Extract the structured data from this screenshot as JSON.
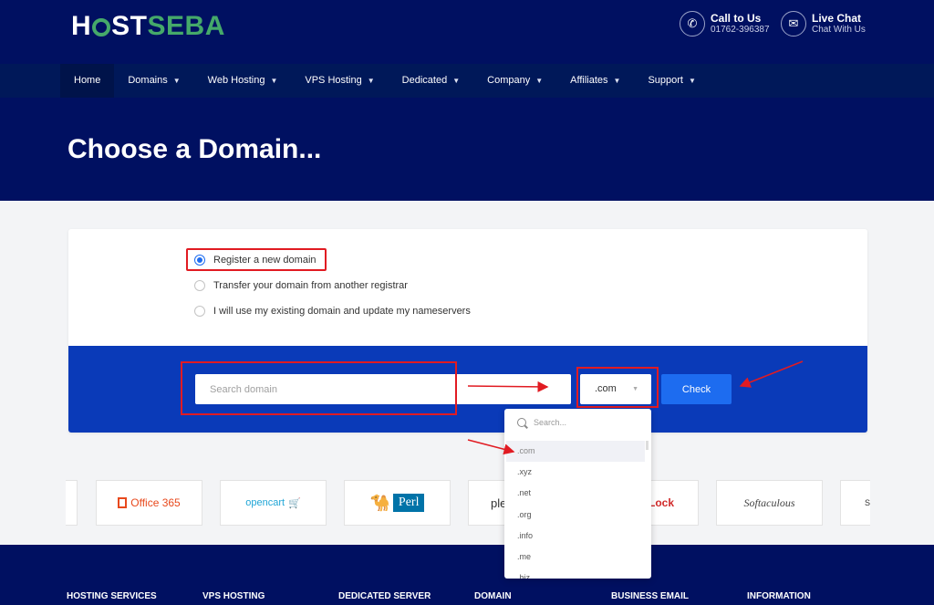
{
  "header": {
    "logo_part1": "H",
    "logo_part2": "ST",
    "logo_part3": "SEBA",
    "call": {
      "title": "Call to Us",
      "number": "01762-396387",
      "icon": "phone-icon"
    },
    "chat": {
      "title": "Live Chat",
      "subtitle": "Chat With Us",
      "icon": "chat-icon"
    }
  },
  "nav": {
    "items": [
      {
        "label": "Home"
      },
      {
        "label": "Domains",
        "dropdown": true
      },
      {
        "label": "Web Hosting",
        "dropdown": true
      },
      {
        "label": "VPS Hosting",
        "dropdown": true
      },
      {
        "label": "Dedicated",
        "dropdown": true
      },
      {
        "label": "Company",
        "dropdown": true
      },
      {
        "label": "Affiliates",
        "dropdown": true
      },
      {
        "label": "Support",
        "dropdown": true
      }
    ]
  },
  "hero": {
    "title": "Choose a Domain..."
  },
  "options": [
    {
      "label": "Register a new domain",
      "selected": true
    },
    {
      "label": "Transfer your domain from another registrar",
      "selected": false
    },
    {
      "label": "I will use my existing domain and update my nameservers",
      "selected": false
    }
  ],
  "search": {
    "placeholder": "Search domain",
    "tld_value": ".com",
    "check_label": "Check"
  },
  "dropdown": {
    "search_placeholder": "Search...",
    "items": [
      ".com",
      ".xyz",
      ".net",
      ".org",
      ".info",
      ".me",
      ".biz"
    ]
  },
  "logos": {
    "office": "Office 365",
    "opencart": "opencart",
    "perl": "Perl",
    "plesk": "ple",
    "lock": "Lock",
    "softaculous": "Softaculous",
    "last": "S"
  },
  "footer": {
    "columns": [
      "HOSTING SERVICES",
      "VPS HOSTING",
      "DEDICATED SERVER",
      "DOMAIN",
      "BUSINESS EMAIL",
      "INFORMATION"
    ]
  },
  "colors": {
    "navy": "#001061",
    "band": "#0a3ab8",
    "accent": "#1d6cf0",
    "brand_green": "#45a96a",
    "highlight": "#e11b22"
  }
}
